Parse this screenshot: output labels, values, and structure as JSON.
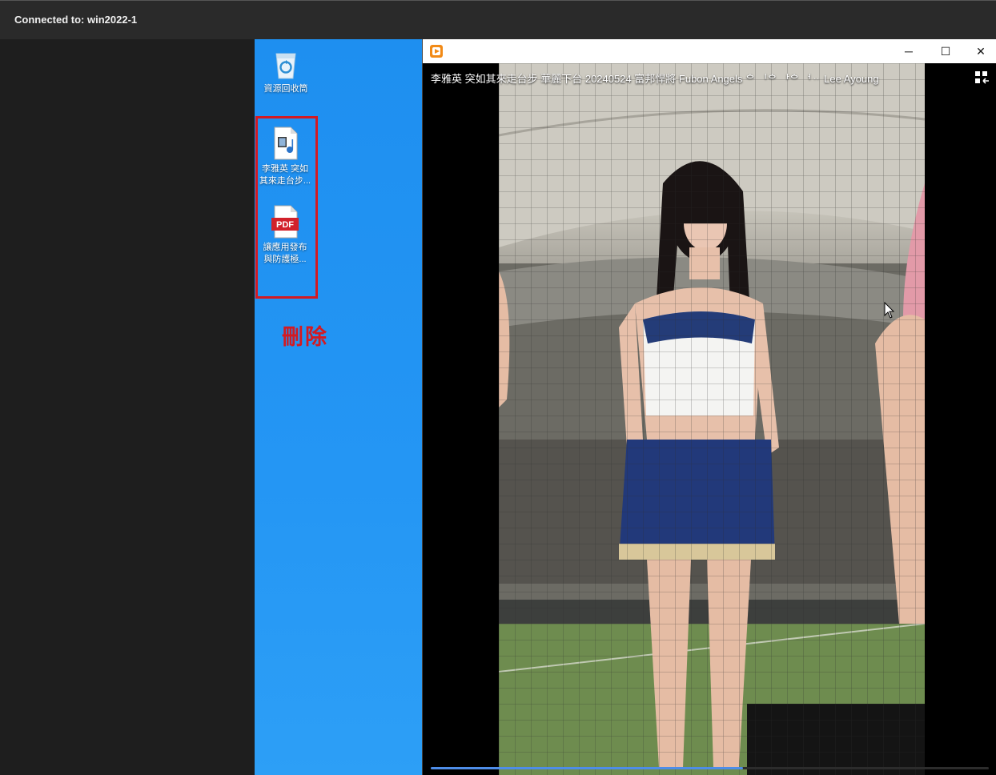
{
  "remote": {
    "connection_label": "Connected to: win2022-1"
  },
  "desktop": {
    "icons": [
      {
        "name": "recycle-bin",
        "label": "資源回收筒"
      },
      {
        "name": "video-file",
        "label_line1": "李雅英 突如",
        "label_line2": "其來走台步..."
      },
      {
        "name": "pdf-file",
        "badge": "PDF",
        "label_line1": "讓應用發布",
        "label_line2": "與防護極..."
      }
    ],
    "annotation": "刪除",
    "colors": {
      "annotation": "#d31a22",
      "desktop": "#2496f4"
    }
  },
  "player": {
    "video_title": "李雅英 突如其來走台步 華麗下台  20240524 富邦悍將 Fubon Angels ᅌ ᅵᅌ ᅡᅌ ᅥᆢ Lee Ayoung",
    "buttons": {
      "minimize": "─",
      "maximize": "☐",
      "close": "✕"
    },
    "progress": 0.56,
    "colors": {
      "accent": "#f28a16",
      "progress": "#4e8de8"
    }
  }
}
